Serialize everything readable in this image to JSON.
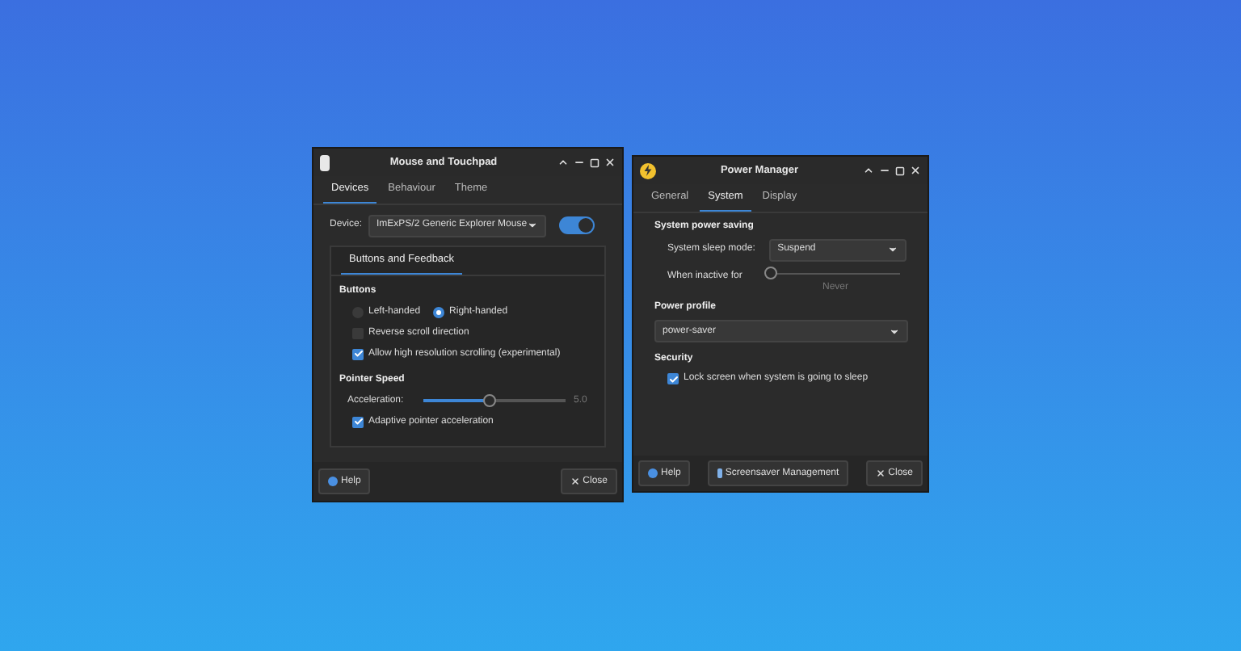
{
  "mouse_window": {
    "title": "Mouse and Touchpad",
    "tabs": [
      {
        "label": "Devices",
        "selected": true
      },
      {
        "label": "Behaviour",
        "selected": false
      },
      {
        "label": "Theme",
        "selected": false
      }
    ],
    "device": {
      "label": "Device:",
      "value": "ImExPS/2 Generic Explorer Mouse",
      "on": true
    },
    "subtabs": [
      {
        "label": "Buttons and Feedback",
        "selected": true
      }
    ],
    "buttons_section": {
      "title": "Buttons",
      "radios": [
        {
          "label": "Left-handed",
          "selected": false
        },
        {
          "label": "Right-handed",
          "selected": true
        }
      ],
      "checks": [
        {
          "label": "Reverse scroll direction",
          "checked": false
        },
        {
          "label": "Allow high resolution scrolling (experimental)",
          "checked": true
        }
      ]
    },
    "pointer_speed": {
      "title": "Pointer Speed",
      "label": "Acceleration:",
      "level": 0.47,
      "reading": "5.0",
      "check": {
        "label": "Adaptive pointer acceleration",
        "checked": true
      }
    },
    "footer": [
      {
        "kind": "help",
        "label": "Help"
      },
      {
        "kind": "close",
        "label": "Close"
      }
    ]
  },
  "power_window": {
    "title": "Power Manager",
    "tabs": [
      {
        "label": "General",
        "selected": false
      },
      {
        "label": "System",
        "selected": true
      },
      {
        "label": "Display",
        "selected": false
      }
    ],
    "saving": {
      "title": "System power saving",
      "sleep_label": "System sleep mode:",
      "sleep_value": "Suspend",
      "inactive_label": "When inactive for",
      "level": 0,
      "reading": "Never"
    },
    "profile": {
      "title": "Power profile",
      "value": "power-saver"
    },
    "security": {
      "title": "Security",
      "check": {
        "label": "Lock screen when system is going to sleep",
        "checked": true
      }
    },
    "footer": [
      {
        "kind": "help",
        "label": "Help"
      },
      {
        "kind": "screensaver",
        "label": "Screensaver Management"
      },
      {
        "kind": "close",
        "label": "Close"
      }
    ]
  }
}
